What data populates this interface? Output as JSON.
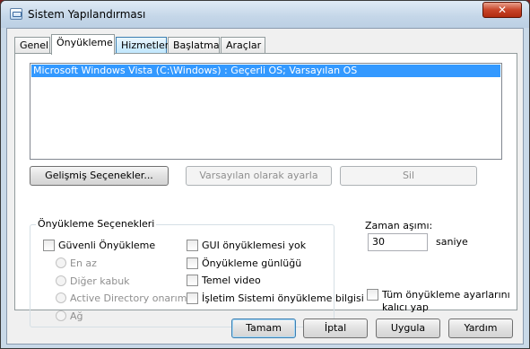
{
  "window": {
    "title": "Sistem Yapılandırması",
    "close_glyph": "✕"
  },
  "tabs": [
    {
      "label": "Genel"
    },
    {
      "label": "Önyükleme"
    },
    {
      "label": "Hizmetler"
    },
    {
      "label": "Başlatma"
    },
    {
      "label": "Araçlar"
    }
  ],
  "os_list": [
    {
      "label": "Microsoft Windows Vista (C:\\Windows) : Geçerli OS; Varsayılan OS",
      "selected": true
    }
  ],
  "list_buttons": {
    "advanced": "Gelişmiş Seçenekler...",
    "set_default": "Varsayılan olarak ayarla",
    "delete": "Sil"
  },
  "boot_options": {
    "title": "Önyükleme Seçenekleri",
    "safe_boot": "Güvenli Önyükleme",
    "radios": [
      "En az",
      "Diğer kabuk",
      "Active Directory onarımı",
      "Ağ"
    ],
    "right_checks": [
      "GUI önyüklemesi yok",
      "Önyükleme günlüğü",
      "Temel video",
      "İşletim Sistemi önyükleme bilgisi"
    ]
  },
  "timeout": {
    "label": "Zaman aşımı:",
    "value": "30",
    "unit": "saniye"
  },
  "permanent": {
    "line1": "Tüm önyükleme ayarlarını",
    "line2": "kalıcı yap"
  },
  "footer": {
    "ok": "Tamam",
    "cancel": "İptal",
    "apply": "Uygula",
    "help": "Yardım"
  }
}
